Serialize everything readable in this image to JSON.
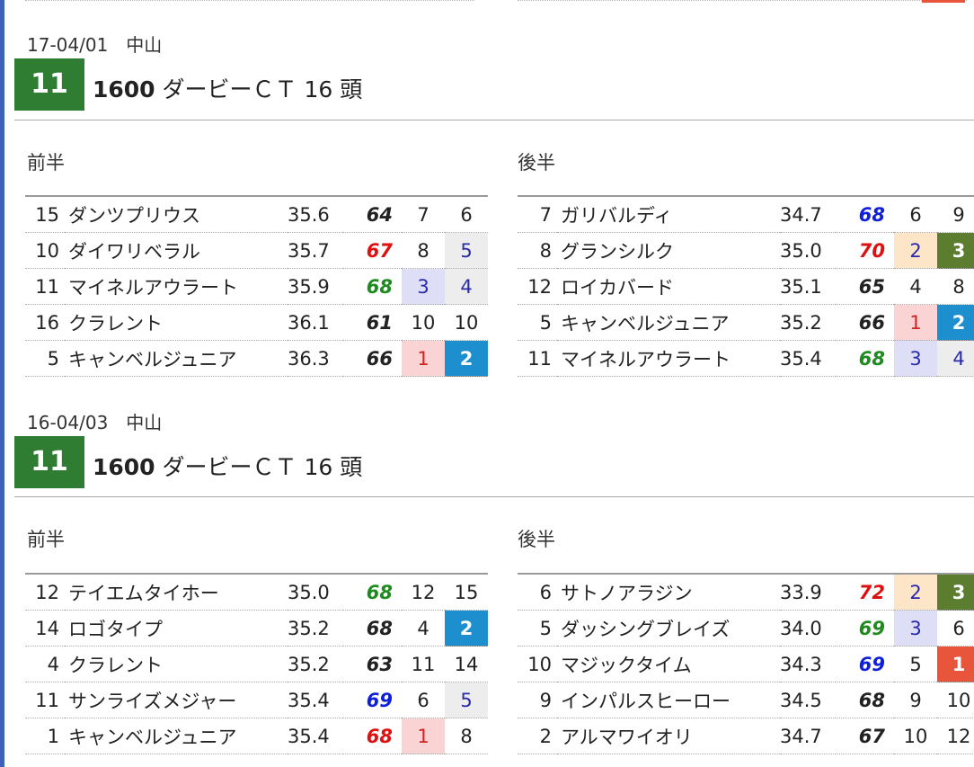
{
  "races": [
    {
      "date": "17-04/01　中山",
      "race_no": "11",
      "distance": "1600",
      "title_rest": " ダービーＣＴ 16 頭",
      "first_label": "前半",
      "second_label": "後半",
      "first": [
        {
          "no": "15",
          "name": "ダンツプリウス",
          "time": "35.6",
          "index": "64",
          "idx_color": "black",
          "r1": "7",
          "r1_style": "none",
          "r2": "6",
          "r2_style": "none"
        },
        {
          "no": "10",
          "name": "ダイワリベラル",
          "time": "35.7",
          "index": "67",
          "idx_color": "red",
          "r1": "8",
          "r1_style": "none",
          "r2": "5",
          "r2_style": "gray"
        },
        {
          "no": "11",
          "name": "マイネルアウラート",
          "time": "35.9",
          "index": "68",
          "idx_color": "green",
          "r1": "3",
          "r1_style": "lav",
          "r2": "4",
          "r2_style": "gray"
        },
        {
          "no": "16",
          "name": "クラレント",
          "time": "36.1",
          "index": "61",
          "idx_color": "black",
          "r1": "10",
          "r1_style": "none",
          "r2": "10",
          "r2_style": "none"
        },
        {
          "no": "5",
          "name": "キャンベルジュニア",
          "time": "36.3",
          "index": "66",
          "idx_color": "black",
          "r1": "1",
          "r1_style": "pink",
          "r2": "2",
          "r2_style": "blue"
        }
      ],
      "second": [
        {
          "no": "7",
          "name": "ガリバルディ",
          "time": "34.7",
          "index": "68",
          "idx_color": "blue",
          "r1": "6",
          "r1_style": "none",
          "r2": "9",
          "r2_style": "none"
        },
        {
          "no": "8",
          "name": "グランシルク",
          "time": "35.0",
          "index": "70",
          "idx_color": "red",
          "r1": "2",
          "r1_style": "peach",
          "r2": "3",
          "r2_style": "olive"
        },
        {
          "no": "12",
          "name": "ロイカバード",
          "time": "35.1",
          "index": "65",
          "idx_color": "black",
          "r1": "4",
          "r1_style": "none",
          "r2": "8",
          "r2_style": "none"
        },
        {
          "no": "5",
          "name": "キャンベルジュニア",
          "time": "35.2",
          "index": "66",
          "idx_color": "black",
          "r1": "1",
          "r1_style": "pink",
          "r2": "2",
          "r2_style": "blue"
        },
        {
          "no": "11",
          "name": "マイネルアウラート",
          "time": "35.4",
          "index": "68",
          "idx_color": "green",
          "r1": "3",
          "r1_style": "lav",
          "r2": "4",
          "r2_style": "gray"
        }
      ]
    },
    {
      "date": "16-04/03　中山",
      "race_no": "11",
      "distance": "1600",
      "title_rest": " ダービーＣＴ 16 頭",
      "first_label": "前半",
      "second_label": "後半",
      "first": [
        {
          "no": "12",
          "name": "テイエムタイホー",
          "time": "35.0",
          "index": "68",
          "idx_color": "green",
          "r1": "12",
          "r1_style": "none",
          "r2": "15",
          "r2_style": "none"
        },
        {
          "no": "14",
          "name": "ロゴタイプ",
          "time": "35.2",
          "index": "68",
          "idx_color": "black",
          "r1": "4",
          "r1_style": "none",
          "r2": "2",
          "r2_style": "blue"
        },
        {
          "no": "4",
          "name": "クラレント",
          "time": "35.2",
          "index": "63",
          "idx_color": "black",
          "r1": "11",
          "r1_style": "none",
          "r2": "14",
          "r2_style": "none"
        },
        {
          "no": "11",
          "name": "サンライズメジャー",
          "time": "35.4",
          "index": "69",
          "idx_color": "blue",
          "r1": "6",
          "r1_style": "none",
          "r2": "5",
          "r2_style": "gray"
        },
        {
          "no": "1",
          "name": "キャンベルジュニア",
          "time": "35.4",
          "index": "68",
          "idx_color": "red",
          "r1": "1",
          "r1_style": "pink",
          "r2": "8",
          "r2_style": "none"
        }
      ],
      "second": [
        {
          "no": "6",
          "name": "サトノアラジン",
          "time": "33.9",
          "index": "72",
          "idx_color": "red",
          "r1": "2",
          "r1_style": "peach",
          "r2": "3",
          "r2_style": "olive"
        },
        {
          "no": "5",
          "name": "ダッシングブレイズ",
          "time": "34.0",
          "index": "69",
          "idx_color": "green",
          "r1": "3",
          "r1_style": "lav",
          "r2": "6",
          "r2_style": "none"
        },
        {
          "no": "10",
          "name": "マジックタイム",
          "time": "34.3",
          "index": "69",
          "idx_color": "blue",
          "r1": "5",
          "r1_style": "none",
          "r2": "1",
          "r2_style": "red"
        },
        {
          "no": "9",
          "name": "インパルスヒーロー",
          "time": "34.5",
          "index": "68",
          "idx_color": "black",
          "r1": "9",
          "r1_style": "none",
          "r2": "10",
          "r2_style": "none"
        },
        {
          "no": "2",
          "name": "アルマワイオリ",
          "time": "34.7",
          "index": "67",
          "idx_color": "black",
          "r1": "10",
          "r1_style": "none",
          "r2": "12",
          "r2_style": "none"
        }
      ]
    }
  ]
}
